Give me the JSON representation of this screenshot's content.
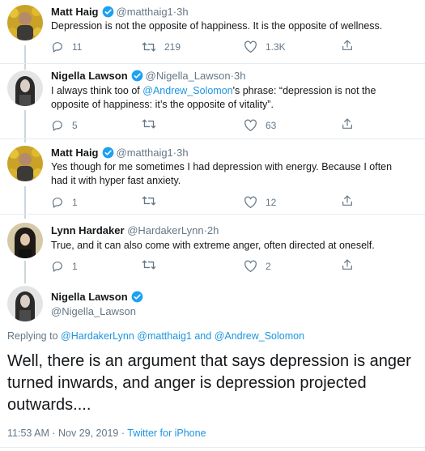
{
  "tweets": [
    {
      "name": "Matt Haig",
      "handle": "@matthaig1",
      "time": "3h",
      "text": "Depression is not the opposite of happiness. It is the opposite of wellness.",
      "replies": "11",
      "retweets": "219",
      "likes": "1.3K"
    },
    {
      "name": "Nigella Lawson",
      "handle": "@Nigella_Lawson",
      "time": "3h",
      "text_before": "I always think too of ",
      "mention": "@Andrew_Solomon",
      "text_after": "'s phrase: “depression is not the opposite of happiness: it’s the opposite of vitality”.",
      "replies": "5",
      "retweets": "",
      "likes": "63"
    },
    {
      "name": "Matt Haig",
      "handle": "@matthaig1",
      "time": "3h",
      "text": "Yes though for me sometimes I had depression with energy. Because I often had it with hyper fast anxiety.",
      "replies": "1",
      "retweets": "",
      "likes": "12"
    },
    {
      "name": "Lynn Hardaker",
      "handle": "@HardakerLynn",
      "time": "2h",
      "text": "True, and it can also come with extreme anger, often directed at oneself.",
      "replies": "1",
      "retweets": "",
      "likes": "2"
    }
  ],
  "main_tweet": {
    "name": "Nigella Lawson",
    "handle": "@Nigella_Lawson",
    "replying_prefix": "Replying to",
    "replying_mention_1": "@HardakerLynn",
    "replying_mention_2": "@matthaig1",
    "replying_and": "and",
    "replying_mention_3": "@Andrew_Solomon",
    "text": "Well, there is an argument that says depression is anger turned inwards, and anger is depression projected outwards....",
    "timestamp": "11:53 AM · Nov 29, 2019 · ",
    "source": "Twitter for iPhone"
  },
  "separator": "·",
  "icons": {
    "verified": "verified-badge-icon",
    "reply": "reply-icon",
    "retweet": "retweet-icon",
    "like": "like-icon",
    "share": "share-icon"
  },
  "colors": {
    "accent": "#1b95e0",
    "verified": "#1da1f2",
    "muted": "#657786",
    "text": "#14171a"
  }
}
